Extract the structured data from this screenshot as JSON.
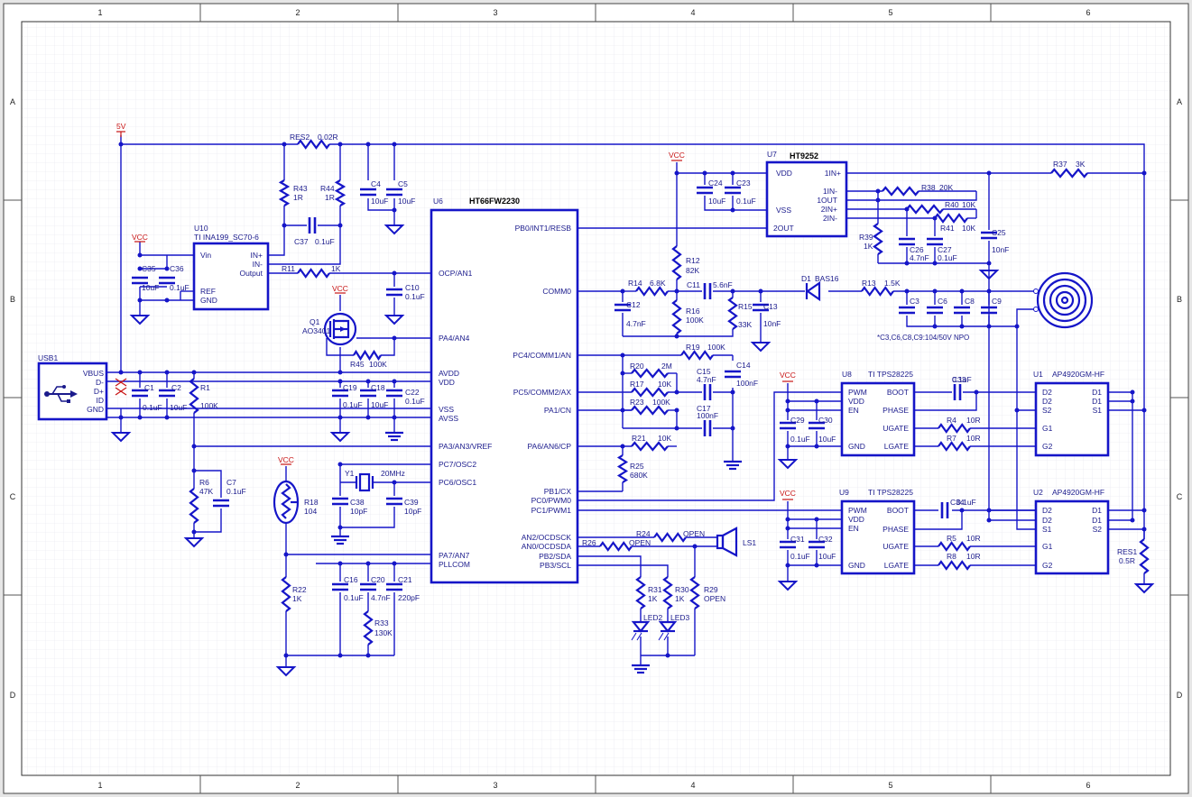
{
  "frame": {
    "columns": [
      "1",
      "2",
      "3",
      "4",
      "5",
      "6"
    ],
    "rows": [
      "A",
      "B",
      "C",
      "D"
    ]
  },
  "power": {
    "v5": "5V",
    "vcc": "VCC"
  },
  "ics": {
    "u6": {
      "ref": "U6",
      "name": "HT66FW2230",
      "left_pins": [
        "OCP/AN1",
        "PA4/AN4",
        "AVDD",
        "VDD",
        "VSS",
        "AVSS",
        "PA3/AN3/VREF",
        "PC7/OSC2",
        "PC6/OSC1",
        "PA7/AN7",
        "PLLCOM"
      ],
      "right_pins": [
        "PB0/INT1/RESB",
        "COMM0",
        "PC4/COMM1/AN",
        "PC5/COMM2/AX",
        "PA1/CN",
        "PA6/AN6/CP",
        "PB1/CX",
        "PC0/PWM0",
        "PC1/PWM1",
        "AN2/OCDSCK",
        "AN0/OCDSDA",
        "PB2/SDA",
        "PB3/SCL"
      ]
    },
    "u7": {
      "ref": "U7",
      "name": "HT9252",
      "left_pins": [
        "VDD",
        "VSS",
        "2OUT"
      ],
      "right_pins": [
        "1IN+",
        "1IN-",
        "1OUT",
        "2IN+",
        "2IN-"
      ]
    },
    "u10": {
      "ref": "U10",
      "name": "TI INA199_SC70-6",
      "left_pins": [
        "Vin",
        "REF",
        "GND"
      ],
      "right_pins": [
        "IN+",
        "IN-",
        "Output"
      ]
    },
    "u8": {
      "ref": "U8",
      "name": "TI TPS28225",
      "left_pins": [
        "PWM",
        "VDD",
        "EN",
        "GND"
      ],
      "right_pins": [
        "BOOT",
        "PHASE",
        "UGATE",
        "LGATE"
      ]
    },
    "u9": {
      "ref": "U9",
      "name": "TI TPS28225",
      "left_pins": [
        "PWM",
        "VDD",
        "EN",
        "GND"
      ],
      "right_pins": [
        "BOOT",
        "PHASE",
        "UGATE",
        "LGATE"
      ]
    },
    "u1": {
      "ref": "U1",
      "name": "AP4920GM-HF",
      "left_pins": [
        "D2",
        "D2",
        "S2",
        "G1",
        "G2"
      ],
      "right_pins": [
        "D1",
        "D1",
        "S1"
      ]
    },
    "u2": {
      "ref": "U2",
      "name": "AP4920GM-HF",
      "left_pins": [
        "D2",
        "D2",
        "S1",
        "G1",
        "G2"
      ],
      "right_pins": [
        "D1",
        "D1",
        "S2"
      ]
    },
    "usb": {
      "ref": "USB1",
      "pins": [
        "VBUS",
        "D-",
        "D+",
        "ID",
        "GND"
      ]
    }
  },
  "parts": {
    "res2": {
      "ref": "RES2",
      "val": "0.02R"
    },
    "r43": {
      "ref": "R43",
      "val": "1R"
    },
    "r44": {
      "ref": "R44",
      "val": "1R"
    },
    "c4": {
      "ref": "C4",
      "val": "10uF"
    },
    "c5": {
      "ref": "C5",
      "val": "10uF"
    },
    "c37": {
      "ref": "C37",
      "val": "0.1uF"
    },
    "r11": {
      "ref": "R11",
      "val": "1K"
    },
    "c35": {
      "ref": "C35",
      "val": "10uF"
    },
    "c36": {
      "ref": "C36",
      "val": "0.1uF"
    },
    "c10": {
      "ref": "C10",
      "val": "0.1uF"
    },
    "q1": {
      "ref": "Q1",
      "val": "AO3401"
    },
    "r45": {
      "ref": "R45",
      "val": "100K"
    },
    "c1": {
      "ref": "C1",
      "val": "0.1uF"
    },
    "c2": {
      "ref": "C2",
      "val": "10uF"
    },
    "r1": {
      "ref": "R1",
      "val": "100K"
    },
    "c19": {
      "ref": "C19",
      "val": "0.1uF"
    },
    "c18": {
      "ref": "C18",
      "val": "10uF"
    },
    "c22": {
      "ref": "C22",
      "val": "0.1uF"
    },
    "r6": {
      "ref": "R6",
      "val": "47K"
    },
    "c7": {
      "ref": "C7",
      "val": "0.1uF"
    },
    "y1": {
      "ref": "Y1",
      "val": "20MHz"
    },
    "c38": {
      "ref": "C38",
      "val": "10pF"
    },
    "c39": {
      "ref": "C39",
      "val": "10pF"
    },
    "r18": {
      "ref": "R18",
      "val": "104"
    },
    "r22": {
      "ref": "R22",
      "val": "1K"
    },
    "c16": {
      "ref": "C16",
      "val": "0.1uF"
    },
    "c20": {
      "ref": "C20",
      "val": "4.7nF"
    },
    "c21": {
      "ref": "C21",
      "val": "220pF"
    },
    "r33": {
      "ref": "R33",
      "val": "130K"
    },
    "c24": {
      "ref": "C24",
      "val": "10uF"
    },
    "c23": {
      "ref": "C23",
      "val": "0.1uF"
    },
    "r38": {
      "ref": "R38",
      "val": "20K"
    },
    "r40": {
      "ref": "R40",
      "val": "10K"
    },
    "r41": {
      "ref": "R41",
      "val": "10K"
    },
    "r39": {
      "ref": "R39",
      "val": "1K"
    },
    "c26": {
      "ref": "C26",
      "val": "4.7nF"
    },
    "c27": {
      "ref": "C27",
      "val": "0.1uF"
    },
    "c25": {
      "ref": "C25",
      "val": "10nF"
    },
    "r37": {
      "ref": "R37",
      "val": "3K"
    },
    "r12": {
      "ref": "R12",
      "val": "82K"
    },
    "r14": {
      "ref": "R14",
      "val": "6.8K"
    },
    "c11": {
      "ref": "C11",
      "val": "5.6nF"
    },
    "c12": {
      "ref": "C12",
      "val": "4.7nF"
    },
    "r16": {
      "ref": "R16",
      "val": "100K"
    },
    "r15": {
      "ref": "R15",
      "val": "33K"
    },
    "c13": {
      "ref": "C13",
      "val": "10nF"
    },
    "d1": {
      "ref": "D1",
      "val": "BAS16"
    },
    "r13": {
      "ref": "R13",
      "val": "1.5K"
    },
    "c3": {
      "ref": "C3"
    },
    "c6": {
      "ref": "C6"
    },
    "c8": {
      "ref": "C8"
    },
    "c9": {
      "ref": "C9"
    },
    "r19": {
      "ref": "R19",
      "val": "100K"
    },
    "r20": {
      "ref": "R20",
      "val": "2M"
    },
    "r17": {
      "ref": "R17",
      "val": "10K"
    },
    "c15": {
      "ref": "C15",
      "val": "4.7nF"
    },
    "c14": {
      "ref": "C14",
      "val": "100nF"
    },
    "r23": {
      "ref": "R23",
      "val": "100K"
    },
    "c17": {
      "ref": "C17",
      "val": "100nF"
    },
    "r21": {
      "ref": "R21",
      "val": "10K"
    },
    "r25": {
      "ref": "R25",
      "val": "680K"
    },
    "r26": {
      "ref": "R26",
      "val": "OPEN"
    },
    "r24": {
      "ref": "R24",
      "val": "OPEN"
    },
    "ls1": {
      "ref": "LS1"
    },
    "r31": {
      "ref": "R31",
      "val": "1K"
    },
    "r30": {
      "ref": "R30",
      "val": "1K"
    },
    "r29": {
      "ref": "R29",
      "val": "OPEN"
    },
    "led2": {
      "ref": "LED2"
    },
    "led3": {
      "ref": "LED3"
    },
    "c33": {
      "ref": "C33",
      "val": "0.1uF"
    },
    "c29": {
      "ref": "C29",
      "val": "0.1uF"
    },
    "c30": {
      "ref": "C30",
      "val": "10uF"
    },
    "r4": {
      "ref": "R4",
      "val": "10R"
    },
    "r7": {
      "ref": "R7",
      "val": "10R"
    },
    "c34": {
      "ref": "C34",
      "val": "0.1uF"
    },
    "c31": {
      "ref": "C31",
      "val": "0.1uF"
    },
    "c32": {
      "ref": "C32",
      "val": "10uF"
    },
    "r5": {
      "ref": "R5",
      "val": "10R"
    },
    "r8": {
      "ref": "R8",
      "val": "10R"
    },
    "res1": {
      "ref": "RES1",
      "val": "0.5R"
    }
  },
  "note": "*C3,C6,C8,C9:104/50V NPO"
}
